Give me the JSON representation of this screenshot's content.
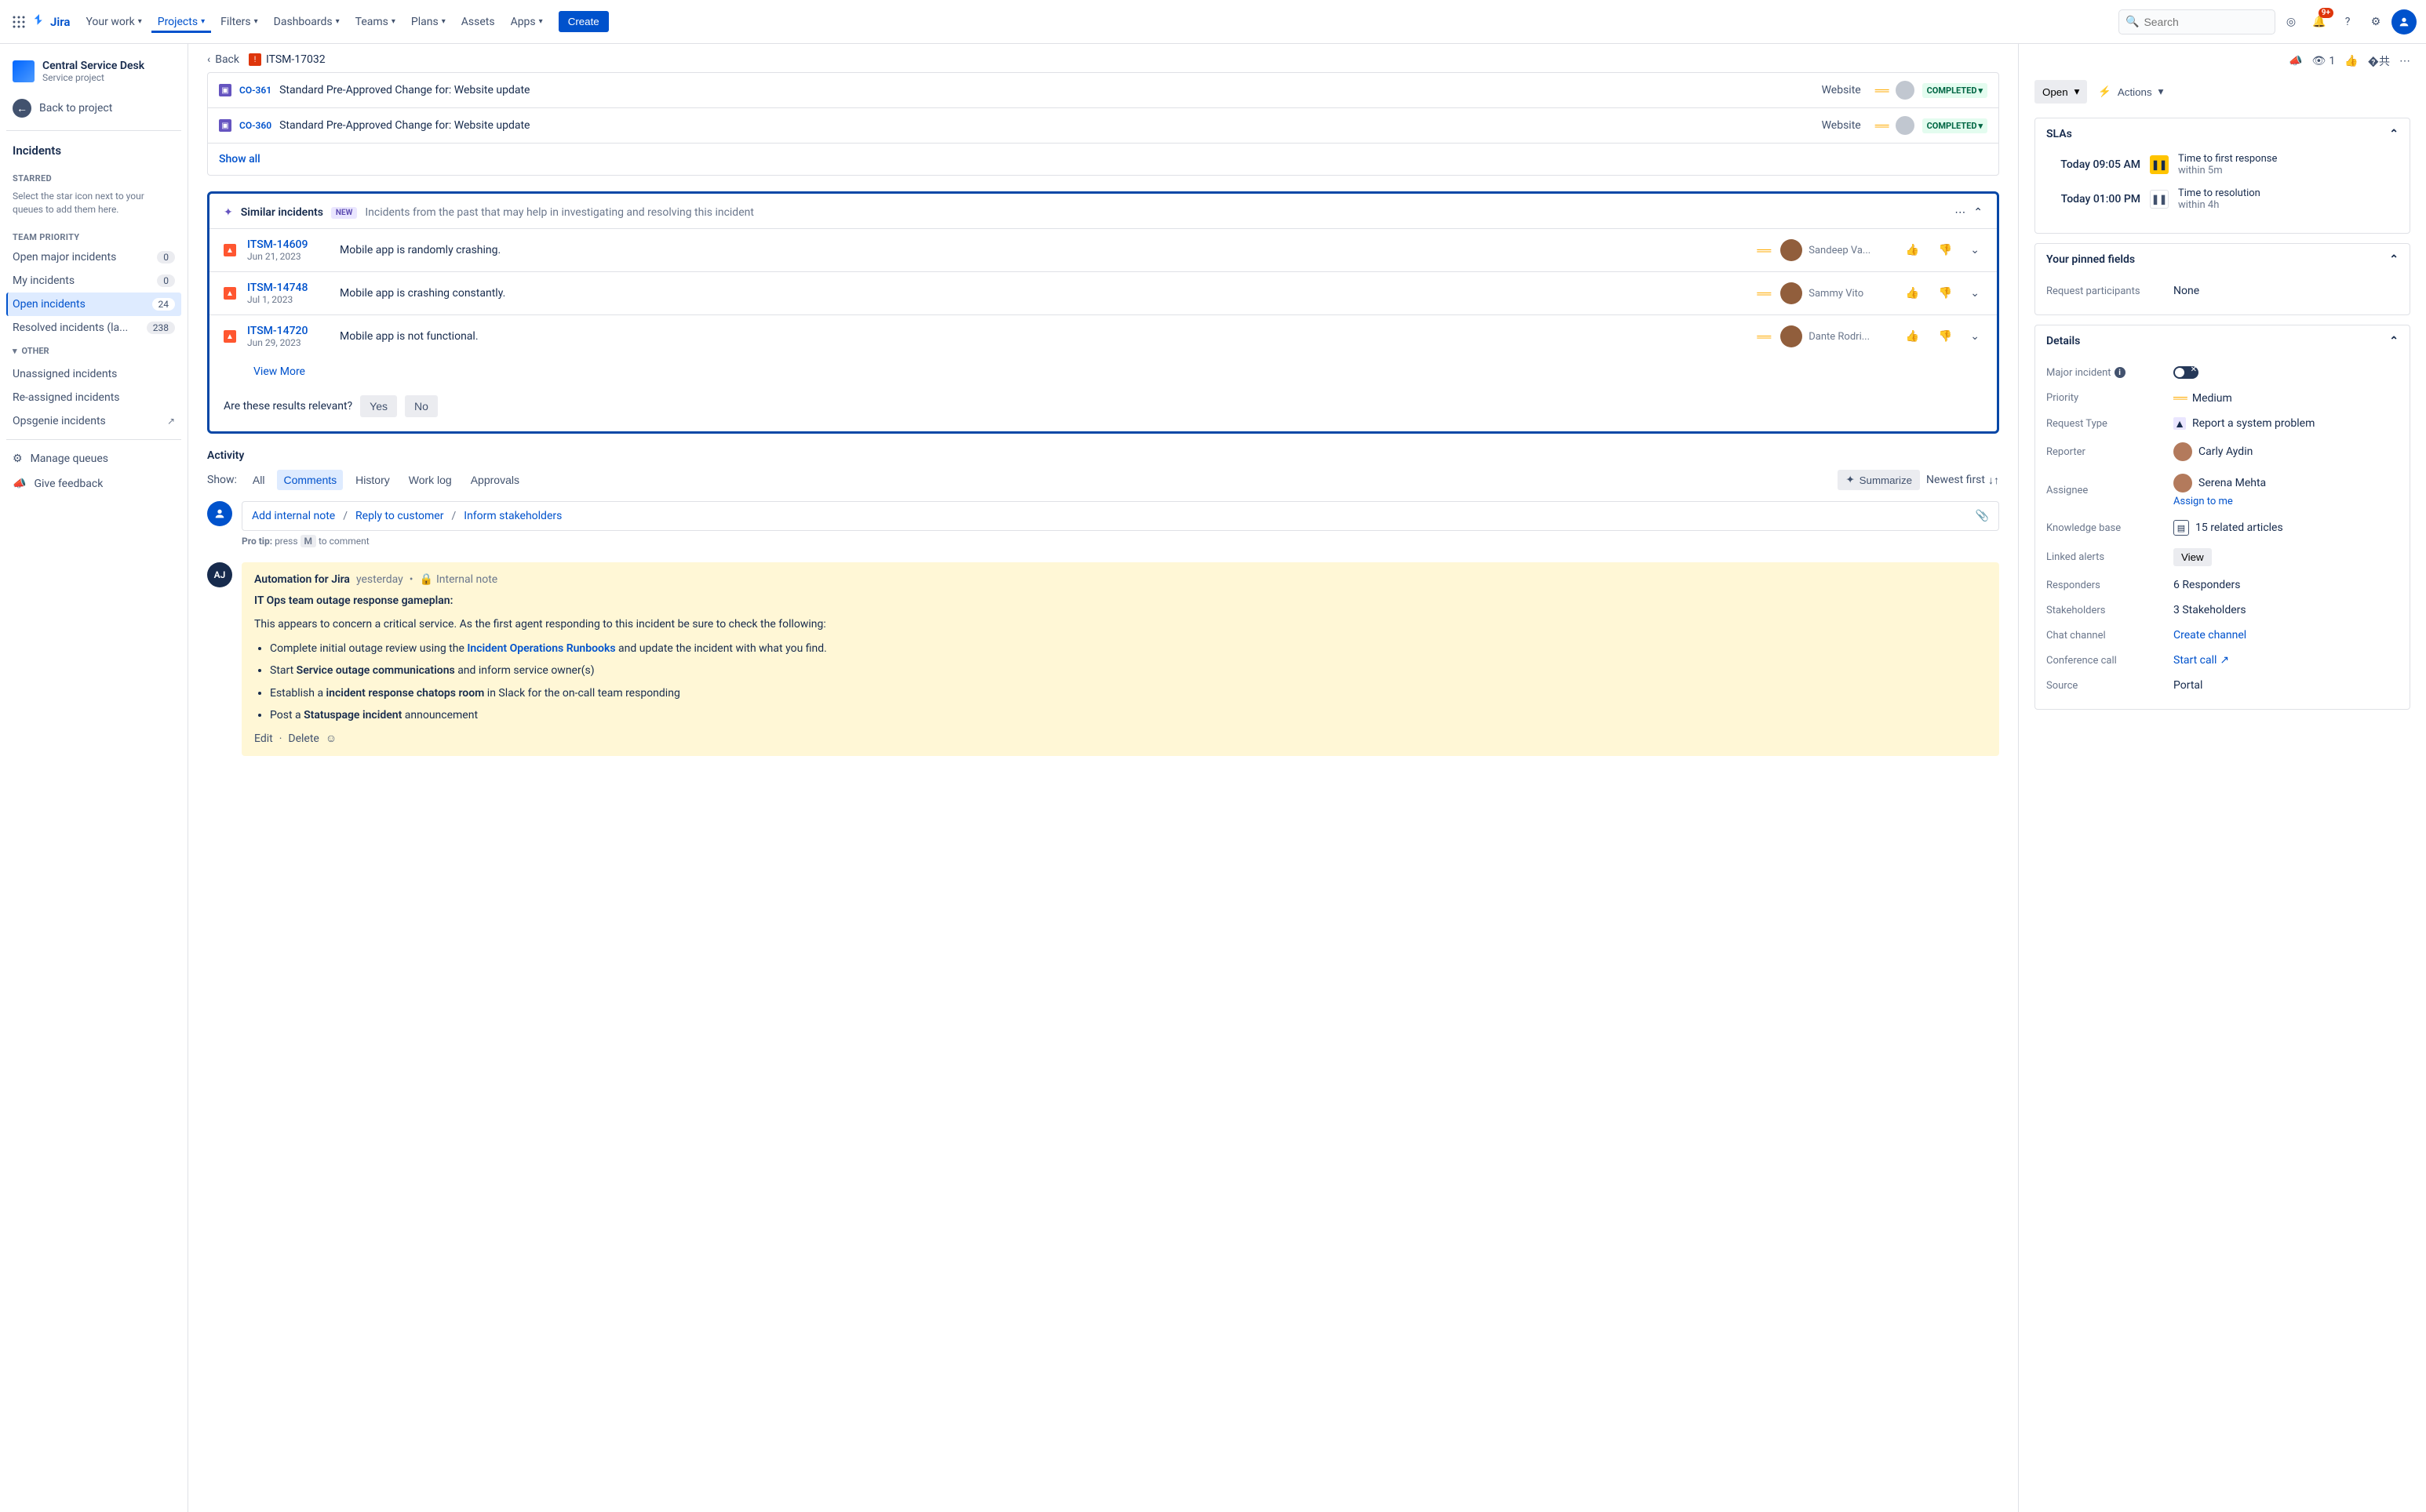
{
  "topnav": {
    "logo": "Jira",
    "items": [
      "Your work",
      "Projects",
      "Filters",
      "Dashboards",
      "Teams",
      "Plans",
      "Assets",
      "Apps"
    ],
    "active_index": 1,
    "create": "Create",
    "search_placeholder": "Search",
    "notif_badge": "9+"
  },
  "sidebar": {
    "project_name": "Central Service Desk",
    "project_type": "Service project",
    "back_link": "Back to project",
    "section_title": "Incidents",
    "starred_label": "STARRED",
    "starred_hint": "Select the star icon next to your queues to add them here.",
    "priority_label": "TEAM PRIORITY",
    "queues": [
      {
        "label": "Open major incidents",
        "count": "0"
      },
      {
        "label": "My incidents",
        "count": "0"
      },
      {
        "label": "Open incidents",
        "count": "24"
      },
      {
        "label": "Resolved incidents (la...",
        "count": "238"
      }
    ],
    "active_queue_index": 2,
    "other_label": "OTHER",
    "other_items": [
      "Unassigned incidents",
      "Re-assigned incidents",
      "Opsgenie incidents"
    ],
    "manage_queues": "Manage queues",
    "give_feedback": "Give feedback"
  },
  "crumbs": {
    "back": "Back",
    "issue_key": "ITSM-17032"
  },
  "linked": [
    {
      "key": "CO-361",
      "summary": "Standard Pre-Approved Change for: Website update",
      "category": "Website",
      "status": "COMPLETED"
    },
    {
      "key": "CO-360",
      "summary": "Standard Pre-Approved Change for: Website update",
      "category": "Website",
      "status": "COMPLETED"
    }
  ],
  "show_all": "Show all",
  "similar": {
    "title": "Similar incidents",
    "new": "NEW",
    "sub": "Incidents from the past that may help in investigating and resolving this incident",
    "rows": [
      {
        "key": "ITSM-14609",
        "date": "Jun 21, 2023",
        "summary": "Mobile app is randomly crashing.",
        "reporter": "Sandeep Va..."
      },
      {
        "key": "ITSM-14748",
        "date": "Jul 1, 2023",
        "summary": "Mobile app is crashing constantly.",
        "reporter": "Sammy Vito"
      },
      {
        "key": "ITSM-14720",
        "date": "Jun 29, 2023",
        "summary": "Mobile app is not functional.",
        "reporter": "Dante Rodri..."
      }
    ],
    "view_more": "View More",
    "relevance_q": "Are these results relevant?",
    "yes": "Yes",
    "no": "No"
  },
  "activity": {
    "title": "Activity",
    "show": "Show:",
    "tabs": [
      "All",
      "Comments",
      "History",
      "Work log",
      "Approvals"
    ],
    "active_tab": 1,
    "summarize": "Summarize",
    "sort": "Newest first",
    "add_internal": "Add internal note",
    "reply": "Reply to customer",
    "inform": "Inform stakeholders",
    "protip_label": "Pro tip:",
    "protip_press": "press",
    "protip_key": "M",
    "protip_tail": "to comment"
  },
  "comment": {
    "avatar": "AJ",
    "author": "Automation for Jira",
    "time": "yesterday",
    "visibility": "Internal note",
    "title": "IT Ops team outage response gameplan:",
    "intro": "This appears to concern a critical service. As the first agent responding to this incident be sure to check the following:",
    "b1_pre": "Complete initial outage review using the ",
    "b1_link": "Incident Operations Runbooks",
    "b1_post": " and update the incident with what you find.",
    "b2_pre": "Start ",
    "b2_bold": "Service outage communications",
    "b2_post": " and inform service owner(s)",
    "b3_pre": "Establish a ",
    "b3_bold": "incident response chatops room",
    "b3_post": " in Slack for the on-call team responding",
    "b4_pre": "Post a ",
    "b4_bold": "Statuspage incident",
    "b4_post": " announcement",
    "edit": "Edit",
    "delete": "Delete"
  },
  "right": {
    "watch": "1",
    "status": "Open",
    "actions": "Actions",
    "slas_title": "SLAs",
    "sla1_time": "Today 09:05 AM",
    "sla1_label": "Time to first response",
    "sla1_sub": "within 5m",
    "sla2_time": "Today 01:00 PM",
    "sla2_label": "Time to resolution",
    "sla2_sub": "within 4h",
    "pinned_title": "Your pinned fields",
    "req_participants_label": "Request participants",
    "req_participants_value": "None",
    "details_title": "Details",
    "fields": {
      "major_incident": "Major incident",
      "priority_label": "Priority",
      "priority_value": "Medium",
      "request_type_label": "Request Type",
      "request_type_value": "Report a system problem",
      "reporter_label": "Reporter",
      "reporter_value": "Carly Aydin",
      "assignee_label": "Assignee",
      "assignee_value": "Serena Mehta",
      "assign_to_me": "Assign to me",
      "kb_label": "Knowledge base",
      "kb_value": "15 related articles",
      "linked_alerts_label": "Linked alerts",
      "linked_alerts_btn": "View",
      "responders_label": "Responders",
      "responders_value": "6 Responders",
      "stakeholders_label": "Stakeholders",
      "stakeholders_value": "3 Stakeholders",
      "chat_label": "Chat channel",
      "chat_action": "Create channel",
      "conf_label": "Conference call",
      "conf_action": "Start call",
      "source_label": "Source",
      "source_value": "Portal"
    }
  }
}
